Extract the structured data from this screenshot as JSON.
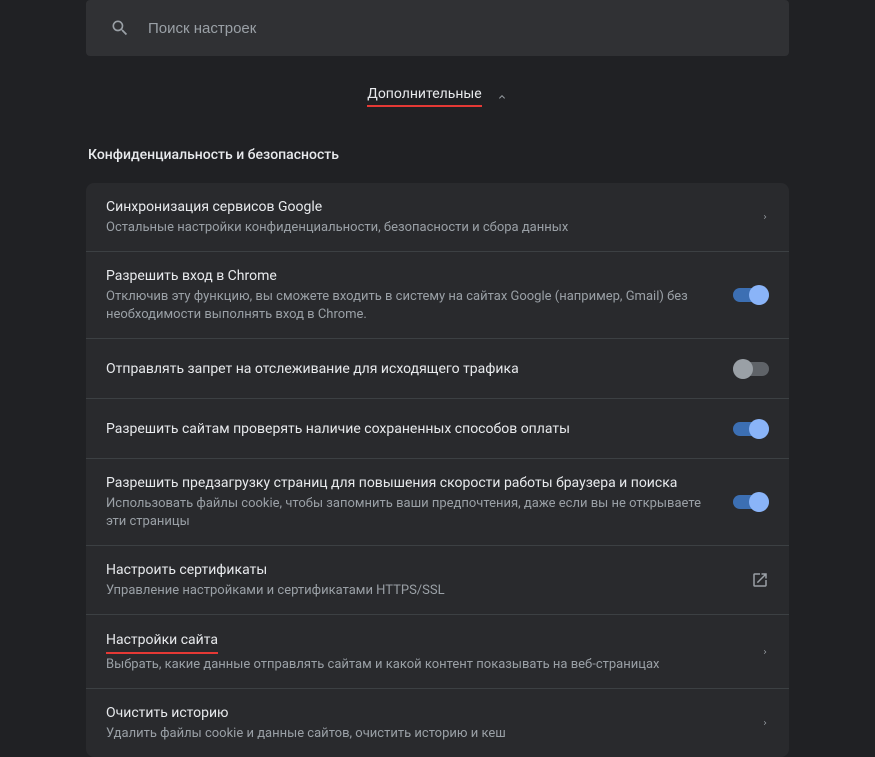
{
  "search": {
    "placeholder": "Поиск настроек"
  },
  "advanced": {
    "label": "Дополнительные"
  },
  "section": {
    "title": "Конфиденциальность и безопасность"
  },
  "rows": [
    {
      "title": "Синхронизация сервисов Google",
      "subtitle": "Остальные настройки конфиденциальности, безопасности и сбора данных",
      "action": "chevron"
    },
    {
      "title": "Разрешить вход в Chrome",
      "subtitle": "Отключив эту функцию, вы сможете входить в систему на сайтах Google (например, Gmail) без необходимости выполнять вход в Chrome.",
      "action": "toggle-on"
    },
    {
      "title": "Отправлять запрет на отслеживание для исходящего трафика",
      "subtitle": "",
      "action": "toggle-off"
    },
    {
      "title": "Разрешить сайтам проверять наличие сохраненных способов оплаты",
      "subtitle": "",
      "action": "toggle-on"
    },
    {
      "title": "Разрешить предзагрузку страниц для повышения скорости работы браузера и поиска",
      "subtitle": "Использовать файлы cookie, чтобы запомнить ваши предпочтения, даже если вы не открываете эти страницы",
      "action": "toggle-on"
    },
    {
      "title": "Настроить сертификаты",
      "subtitle": "Управление настройками и сертификатами HTTPS/SSL",
      "action": "external"
    },
    {
      "title": "Настройки сайта",
      "subtitle": "Выбрать, какие данные отправлять сайтам и какой контент показывать на веб-страницах",
      "action": "chevron",
      "underlined": true
    },
    {
      "title": "Очистить историю",
      "subtitle": "Удалить файлы cookie и данные сайтов, очистить историю и кеш",
      "action": "chevron"
    }
  ]
}
